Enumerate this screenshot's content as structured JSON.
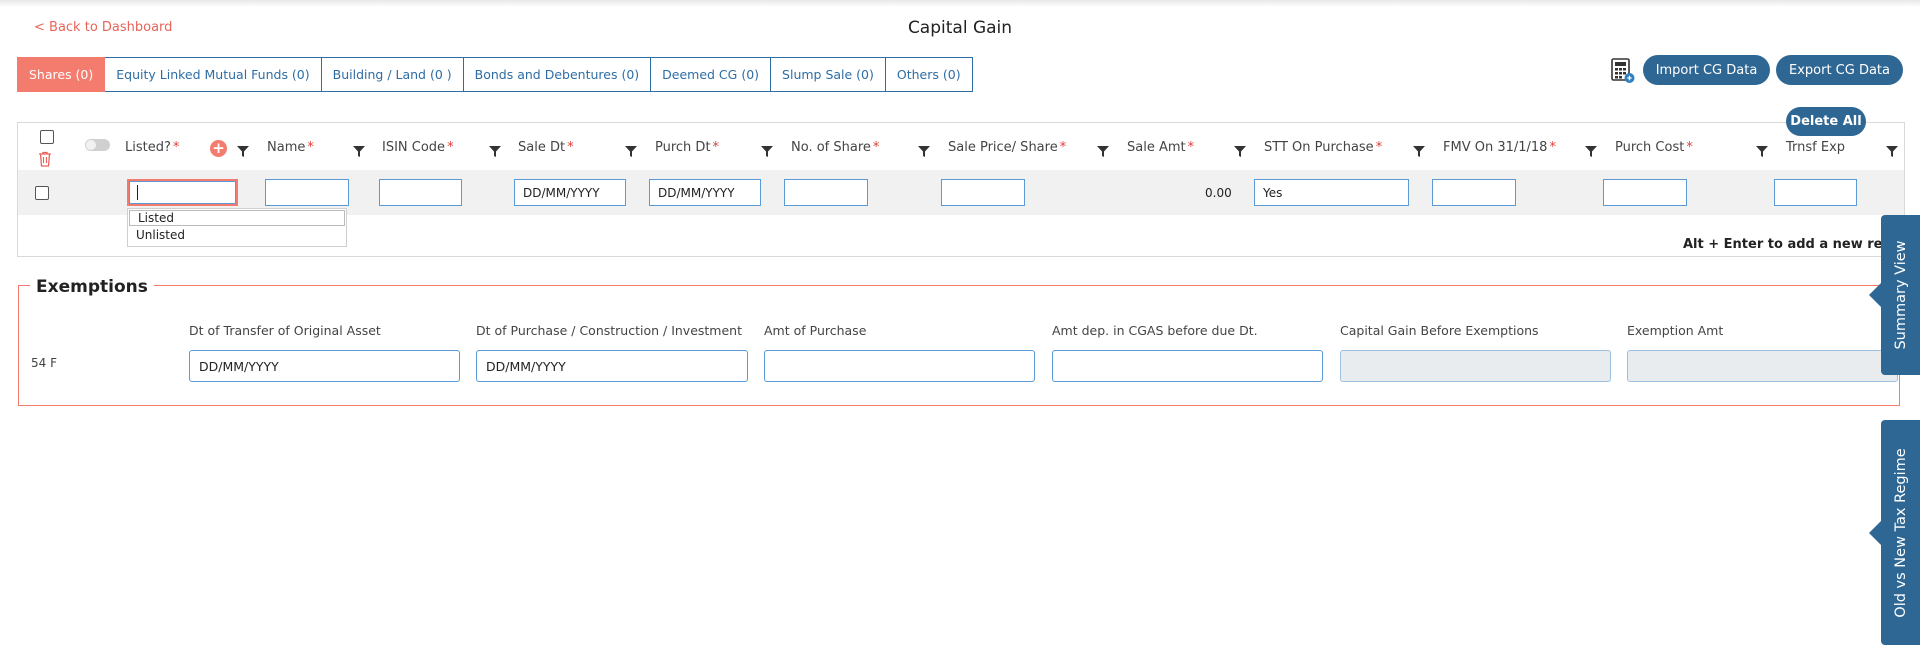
{
  "header": {
    "back_link": "< Back to Dashboard",
    "title": "Capital Gain"
  },
  "tabs": [
    {
      "label": "Shares (0)",
      "active": true
    },
    {
      "label": "Equity Linked Mutual Funds (0)"
    },
    {
      "label": "Building / Land (0 )"
    },
    {
      "label": "Bonds and Debentures (0)"
    },
    {
      "label": "Deemed CG (0)"
    },
    {
      "label": "Slump Sale (0)"
    },
    {
      "label": "Others (0)"
    }
  ],
  "toolbar": {
    "calculator_icon": "calculator-icon",
    "import_label": "Import CG Data",
    "export_label": "Export CG Data",
    "delete_all_label": "Delete All"
  },
  "grid": {
    "columns": [
      {
        "label": "Listed?",
        "required": "*"
      },
      {
        "label": "Name",
        "required": "*"
      },
      {
        "label": "ISIN Code",
        "required": "*"
      },
      {
        "label": "Sale Dt",
        "required": "*"
      },
      {
        "label": "Purch Dt",
        "required": "*"
      },
      {
        "label": "No. of Share",
        "required": "*"
      },
      {
        "label": "Sale Price/ Share",
        "required": "*"
      },
      {
        "label": "Sale Amt",
        "required": "*"
      },
      {
        "label": "STT On Purchase",
        "required": "*"
      },
      {
        "label": "FMV On 31/1/18",
        "required": "*"
      },
      {
        "label": "Purch Cost",
        "required": "*"
      },
      {
        "label": "Trnsf Exp",
        "required": ""
      }
    ],
    "row": {
      "listed": "",
      "name": "",
      "isin": "",
      "sale_dt_placeholder": "DD/MM/YYYY",
      "purch_dt_placeholder": "DD/MM/YYYY",
      "no_of_share": "",
      "sale_price": "",
      "sale_amt": "0.00",
      "stt_on_purchase": "Yes",
      "fmv": "",
      "purch_cost": "",
      "trnsf_exp": ""
    },
    "listed_options": [
      "Listed",
      "Unlisted"
    ],
    "hint": "Alt + Enter to add a new record"
  },
  "exemptions": {
    "title": "Exemptions",
    "section": "54 F",
    "fields": [
      {
        "label": "Dt of Transfer of Original Asset",
        "placeholder": "DD/MM/YYYY"
      },
      {
        "label": "Dt of Purchase / Construction / Investment",
        "placeholder": "DD/MM/YYYY"
      },
      {
        "label": "Amt of Purchase",
        "placeholder": ""
      },
      {
        "label": "Amt dep. in CGAS before due Dt.",
        "placeholder": ""
      },
      {
        "label": "Capital Gain Before Exemptions",
        "placeholder": ""
      },
      {
        "label": "Exemption Amt",
        "placeholder": ""
      }
    ]
  },
  "side_tabs": {
    "summary": "Summary View",
    "regime": "Old vs New Tax Regime"
  },
  "colors": {
    "accent": "#f47c6f",
    "primary": "#2f6794",
    "link": "#2e6da4"
  }
}
